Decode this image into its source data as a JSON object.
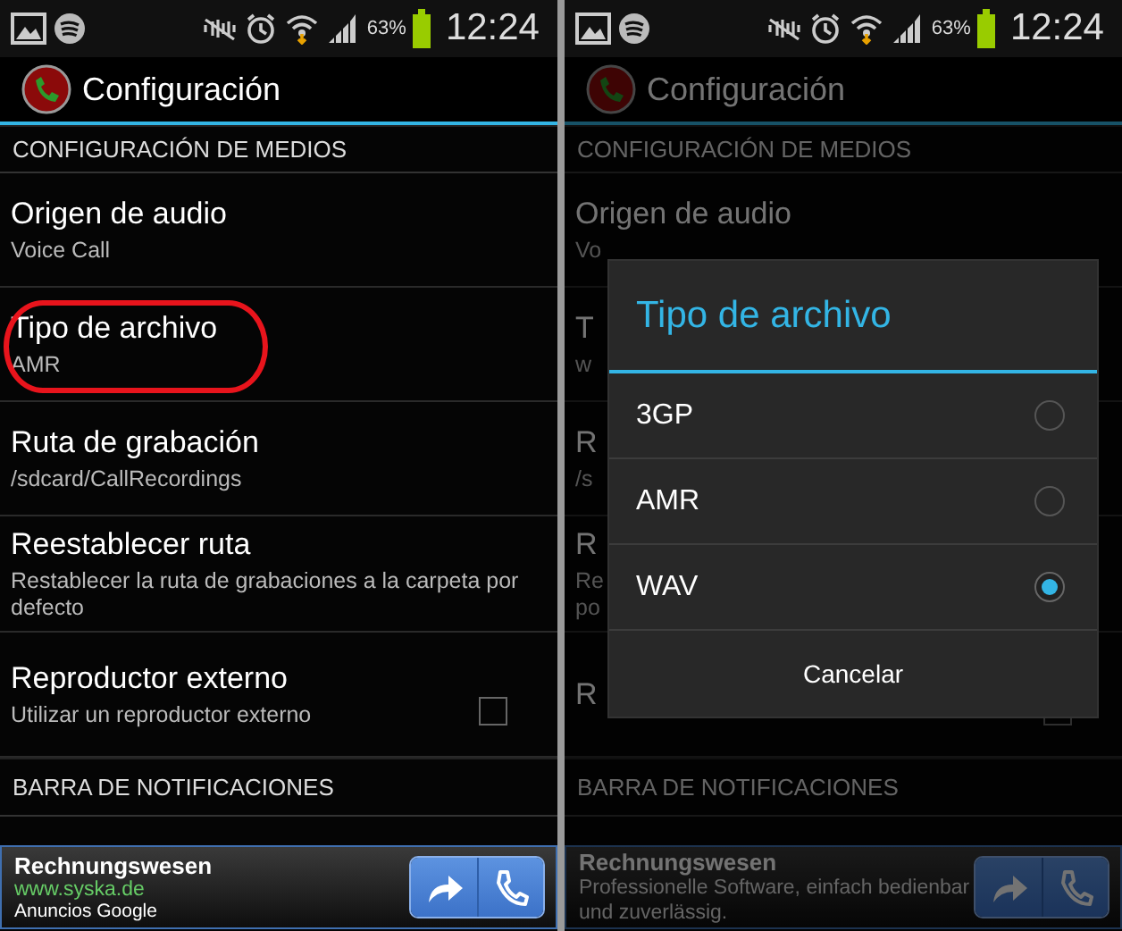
{
  "screens": [
    {
      "status_bar": {
        "battery": "63%",
        "time": "12:24"
      },
      "action_bar": {
        "title": "Configuración"
      },
      "sections": [
        {
          "header": "CONFIGURACIÓN DE MEDIOS",
          "items": [
            {
              "kind": "text",
              "title": "Origen de audio",
              "summary": "Voice Call",
              "highlighted": false
            },
            {
              "kind": "text",
              "title": "Tipo de archivo",
              "summary": "AMR",
              "highlighted": true
            },
            {
              "kind": "text",
              "title": "Ruta de grabación",
              "summary": "/sdcard/CallRecordings",
              "highlighted": false
            },
            {
              "kind": "text",
              "title": "Reestablecer ruta",
              "summary": "Restablecer la ruta de grabaciones a la carpeta por defecto",
              "highlighted": false
            },
            {
              "kind": "checkbox",
              "title": "Reproductor externo",
              "summary": "Utilizar un reproductor externo",
              "checked": false,
              "highlighted": false
            }
          ]
        },
        {
          "header": "BARRA DE NOTIFICACIONES"
        }
      ],
      "ad": {
        "title": "Rechnungswesen",
        "url": "www.syska.de",
        "source": "Anuncios Google"
      }
    },
    {
      "status_bar": {
        "battery": "63%",
        "time": "12:24"
      },
      "action_bar": {
        "title": "Configuración"
      },
      "sections": [
        {
          "header": "CONFIGURACIÓN DE MEDIOS",
          "items": [
            {
              "kind": "text",
              "title": "Origen de audio",
              "summary": "Vo",
              "highlighted": false
            },
            {
              "kind": "text",
              "title": "T",
              "summary": "w",
              "highlighted": false
            },
            {
              "kind": "text",
              "title": "R",
              "summary": "/s",
              "highlighted": false
            },
            {
              "kind": "text",
              "title": "R",
              "summary": "Re\npo",
              "highlighted": false
            },
            {
              "kind": "checkbox",
              "title": "R",
              "checked": false,
              "highlighted": false
            }
          ]
        },
        {
          "header": "BARRA DE NOTIFICACIONES"
        }
      ],
      "ad": {
        "title": "Rechnungswesen",
        "text": "Professionelle Software, einfach bedienbar und zuverlässig."
      },
      "dimmed": true,
      "dialog": {
        "title": "Tipo de archivo",
        "options": [
          {
            "label": "3GP",
            "selected": false
          },
          {
            "label": "AMR",
            "selected": false
          },
          {
            "label": "WAV",
            "selected": true
          }
        ],
        "button": "Cancelar"
      }
    }
  ]
}
